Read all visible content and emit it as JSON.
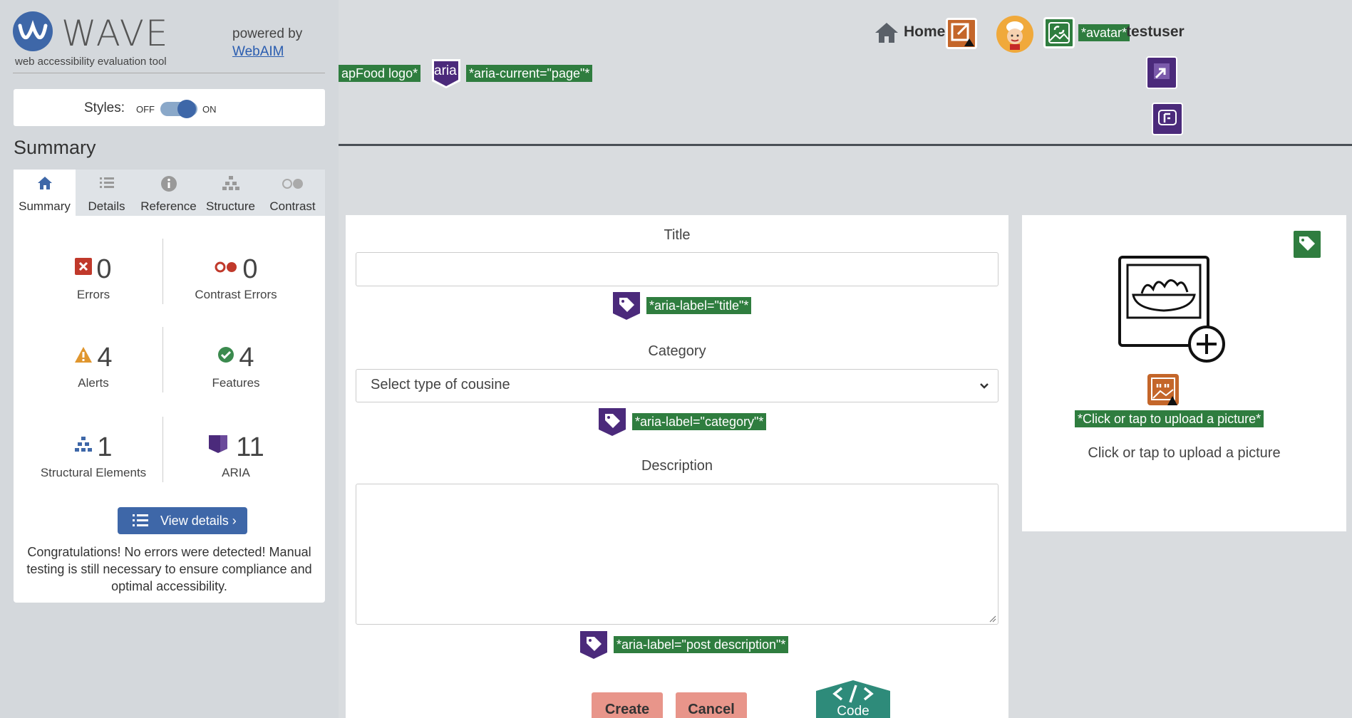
{
  "sidebar": {
    "brand": "WAVE",
    "tagline": "web accessibility evaluation tool",
    "powered_by": "powered by",
    "webaim_link": "WebAIM",
    "styles_label": "Styles:",
    "toggle_off": "OFF",
    "toggle_on": "ON",
    "summary_heading": "Summary",
    "tabs": [
      {
        "label": "Summary",
        "icon": "home-icon"
      },
      {
        "label": "Details",
        "icon": "list-icon"
      },
      {
        "label": "Reference",
        "icon": "info-icon"
      },
      {
        "label": "Structure",
        "icon": "hierarchy-icon"
      },
      {
        "label": "Contrast",
        "icon": "contrast-icon"
      }
    ],
    "stats": {
      "errors": {
        "value": "0",
        "label": "Errors"
      },
      "contrast": {
        "value": "0",
        "label": "Contrast Errors"
      },
      "alerts": {
        "value": "4",
        "label": "Alerts"
      },
      "features": {
        "value": "4",
        "label": "Features"
      },
      "structural": {
        "value": "1",
        "label": "Structural Elements"
      },
      "aria": {
        "value": "11",
        "label": "ARIA"
      }
    },
    "view_details": "View details ›",
    "congrats": "Congratulations! No errors were detected! Manual testing is still necessary to ensure compliance and optimal accessibility."
  },
  "topbar": {
    "logo_tag": "apFood logo*",
    "aria_icon_text": "aria",
    "aria_current_tag": "*aria-current=\"page\"*",
    "home": "Home",
    "avatar_tag": "*avatar*",
    "username": "testuser"
  },
  "form": {
    "title_label": "Title",
    "title_value": "",
    "title_aria": "*aria-label=\"title\"*",
    "category_label": "Category",
    "category_selected": "Select type of cousine",
    "category_aria": "*aria-label=\"category\"*",
    "description_label": "Description",
    "description_value": "",
    "description_aria": "*aria-label=\"post description\"*",
    "create": "Create",
    "cancel": "Cancel",
    "code_label": "Code"
  },
  "upload": {
    "tag": "*Click or tap to upload a picture*",
    "text": "Click or tap to upload a picture"
  },
  "colors": {
    "accent": "#3e67a8",
    "aria_purple": "#4b2a7b",
    "feature_green": "#2f7d3f",
    "alert_orange": "#c4662a",
    "button_rose": "#e8958a"
  }
}
